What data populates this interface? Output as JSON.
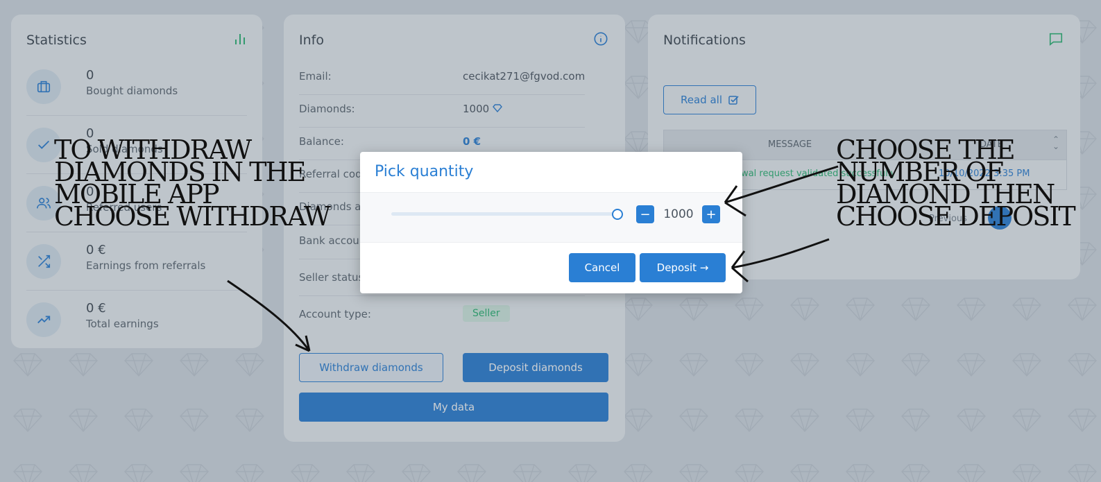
{
  "statistics": {
    "title": "Statistics",
    "items": [
      {
        "value": "0",
        "label": "Bought diamonds",
        "icon": "briefcase-icon"
      },
      {
        "value": "0",
        "label": "Sold diamonds",
        "icon": "check-icon"
      },
      {
        "value": "0",
        "label": "Referred users",
        "icon": "users-icon"
      },
      {
        "value": "0 €",
        "label": "Earnings from referrals",
        "icon": "shuffle-icon"
      },
      {
        "value": "0 €",
        "label": "Total earnings",
        "icon": "trending-up-icon"
      }
    ]
  },
  "info": {
    "title": "Info",
    "rows": [
      {
        "key": "Email:",
        "value": "cecikat271@fgvod.com"
      },
      {
        "key": "Diamonds:",
        "value": "1000"
      },
      {
        "key": "Balance:",
        "value": "0 €"
      },
      {
        "key": "Referral code:",
        "value": ""
      },
      {
        "key": "Diamonds a",
        "value": ""
      },
      {
        "key": "Bank accou",
        "value": ""
      },
      {
        "key": "Seller status",
        "value": ""
      },
      {
        "key": "Account type:",
        "value": "Seller"
      }
    ],
    "withdraw_label": "Withdraw diamonds",
    "deposit_label": "Deposit diamonds",
    "mydata_label": "My data"
  },
  "notifications": {
    "title": "Notifications",
    "read_all_label": "Read all",
    "col_message": "MESSAGE",
    "col_date": "DATE",
    "row_message": "Withdrawal request validated successfully",
    "row_date": "10/10/2022 3:35 PM",
    "pagination": "Previous"
  },
  "modal": {
    "title": "Pick quantity",
    "quantity": "1000",
    "slider_fraction": 1.0,
    "cancel_label": "Cancel",
    "deposit_label": "Deposit →",
    "minus": "−",
    "plus": "+"
  },
  "annotations": {
    "left": "TO WITHDRAW DIAMONDS IN THE MOBILE APP CHOOSE WITHDRAW",
    "right": "CHOOSE THE NUMBER OF DIAMOND THEN CHOOSE DEPOSIT"
  },
  "colors": {
    "primary": "#2a7fd4",
    "accent_green": "#2bb673",
    "text": "#3c4650"
  }
}
